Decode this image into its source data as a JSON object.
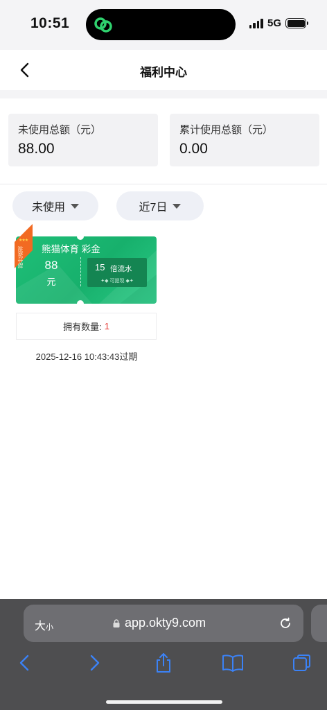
{
  "status_bar": {
    "time": "10:51",
    "network": "5G"
  },
  "header": {
    "title": "福利中心"
  },
  "summary": {
    "unused": {
      "label": "未使用总额（元）",
      "value": "88.00"
    },
    "used": {
      "label": "累计使用总额（元）",
      "value": "0.00"
    }
  },
  "filters": {
    "status": "未使用",
    "period": "近7日"
  },
  "coupon": {
    "ribbon": "部分返现",
    "title": "熊猫体育 彩金",
    "amount": "88",
    "unit": "元",
    "multiplier": "15",
    "multiplier_label": "倍流水",
    "withdraw_note": "可提现",
    "count_label": "拥有数量:",
    "count": "1",
    "expiry": "2025-12-16 10:43:43过期"
  },
  "browser": {
    "aa_big": "大",
    "aa_small": "小",
    "url": "app.okty9.com"
  },
  "colors": {
    "coupon_green": "#1fbf78",
    "count_red": "#e53935",
    "filter_bg": "#eef0f6"
  },
  "icons": [
    "back-arrow-icon",
    "caret-down-icon",
    "lock-icon",
    "reload-icon",
    "share-icon",
    "bookmarks-icon",
    "tabs-icon"
  ]
}
